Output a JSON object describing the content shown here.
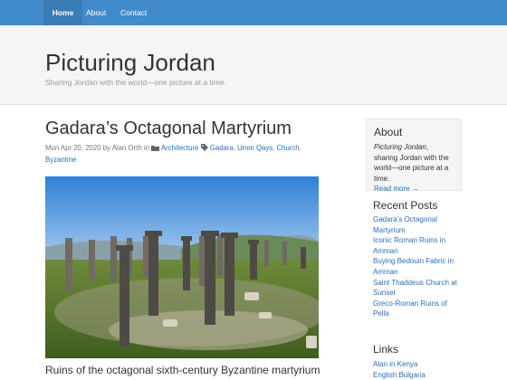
{
  "nav": {
    "items": [
      {
        "label": "Home",
        "active": true
      },
      {
        "label": "About"
      },
      {
        "label": "Contact"
      }
    ],
    "bar_color": "#428bca"
  },
  "header": {
    "title": "Picturing Jordan",
    "tagline": "Sharing Jordan with the world—one picture at a time."
  },
  "post": {
    "title": "Gadara’s Octagonal Martyrium",
    "date": "Mon Apr 20, 2020",
    "by": "by",
    "author": "Alan Orth",
    "in": "in",
    "category": "Architecture",
    "tags": [
      "Gadara",
      "Umm Qays",
      "Church",
      "Byzantine"
    ],
    "caption": "Ruins of the octagonal sixth-century Byzantine martyrium",
    "image_icon": "ruins-photo"
  },
  "sidebar": {
    "about": {
      "title": "About",
      "text_em": "Picturing Jordan",
      "text_rest": ", sharing Jordan with the world—one picture at a time.",
      "read_more": "Read more →"
    },
    "recent": {
      "title": "Recent Posts",
      "items": [
        "Gadara’s Octagonal Martyrium",
        "Iconic Roman Ruins in Amman",
        "Buying Bedouin Fabric in Amman",
        "Saint Thaddeus Church at Sunset",
        "Greco-Roman Ruins of Pella"
      ]
    },
    "links": {
      "title": "Links",
      "items": [
        "Alan in Kenya",
        "English Bulgaria"
      ]
    }
  },
  "colors": {
    "link": "#2a6ebb",
    "header_bg": "#f5f5f5"
  }
}
